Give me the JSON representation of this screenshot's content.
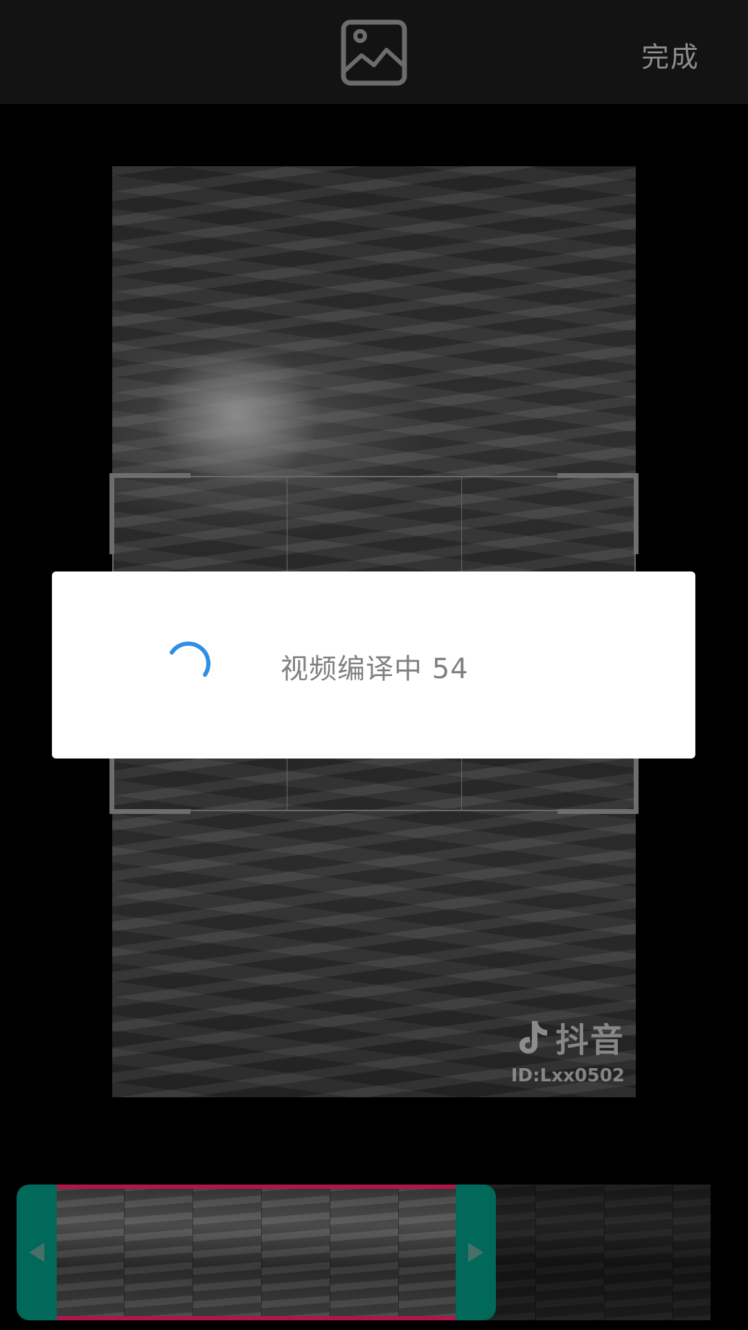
{
  "topbar": {
    "gallery_icon": "image-gallery-icon",
    "done_label": "完成"
  },
  "preview": {
    "watermark_brand": "抖音",
    "watermark_id": "ID:Lxx0502",
    "watermark_icon": "tiktok-note-icon"
  },
  "dialog": {
    "message": "视频编译中 54",
    "progress": 54,
    "spinner_icon": "loading-spinner-icon",
    "accent_color": "#2f8ee6"
  },
  "timeline": {
    "handle_color": "#00695a",
    "selection_color": "#b1154a",
    "left_handle_icon": "arrow-left-icon",
    "right_handle_icon": "arrow-right-icon"
  }
}
